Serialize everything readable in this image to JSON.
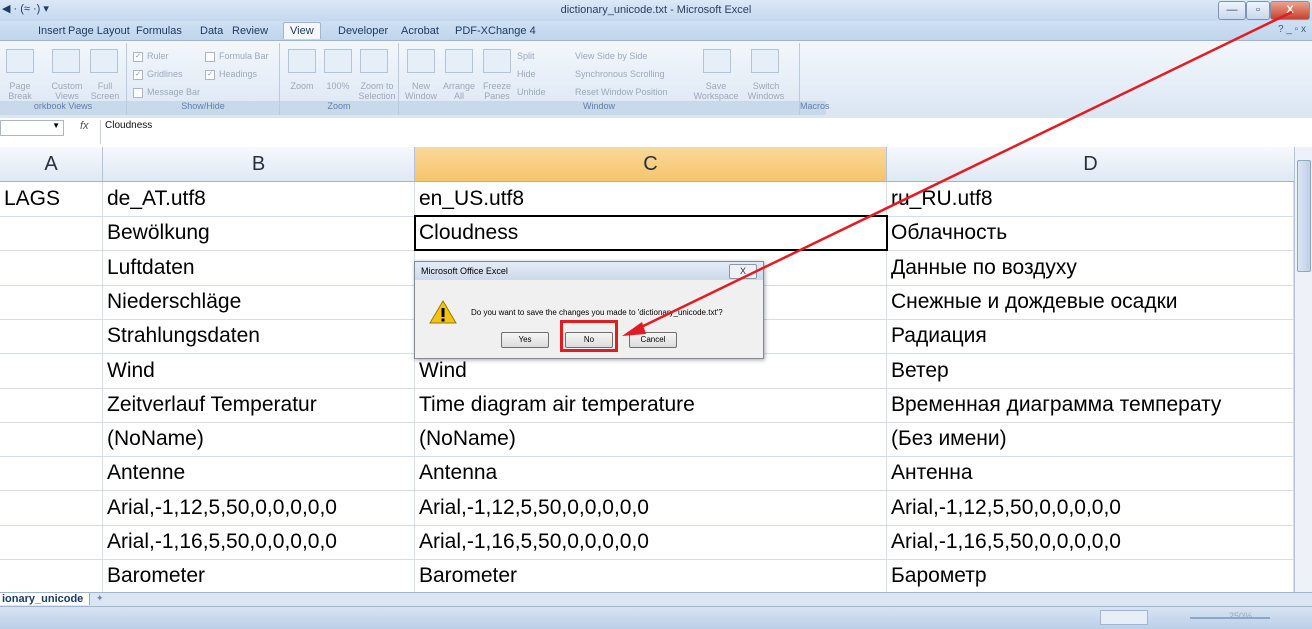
{
  "window": {
    "title": "dictionary_unicode.txt - Microsoft Excel",
    "qat_text": "◀ · (≈ ·) ▾",
    "buttons": {
      "minimize": "—",
      "restore": "▫",
      "close": "X"
    },
    "help": "?",
    "doc_controls": "_ ▫ x"
  },
  "ribbon": {
    "tabs": [
      "Insert",
      "Page Layout",
      "Formulas",
      "Data",
      "Review",
      "View",
      "Developer",
      "Acrobat",
      "PDF-XChange 4"
    ],
    "active_tab": "View",
    "groups": {
      "workbook_views": {
        "label": "orkbook Views",
        "items": [
          "Page Break Preview",
          "Custom Views",
          "Full Screen"
        ]
      },
      "show_hide": {
        "label": "Show/Hide",
        "checks": [
          {
            "label": "Ruler",
            "checked": true
          },
          {
            "label": "Gridlines",
            "checked": true
          },
          {
            "label": "Message Bar",
            "checked": false
          },
          {
            "label": "Formula Bar",
            "checked": false
          },
          {
            "label": "Headings",
            "checked": true
          }
        ]
      },
      "zoom": {
        "label": "Zoom",
        "items": [
          "Zoom",
          "100%",
          "Zoom to Selection"
        ]
      },
      "window": {
        "label": "Window",
        "items": [
          "New Window",
          "Arrange All",
          "Freeze Panes",
          "Split",
          "Hide",
          "Unhide",
          "View Side by Side",
          "Synchronous Scrolling",
          "Reset Window Position",
          "Save Workspace",
          "Switch Windows"
        ]
      },
      "macros": {
        "label": "Macros"
      }
    }
  },
  "formula_bar": {
    "name_box": "",
    "fx": "fx",
    "content": "Cloudness"
  },
  "columns": [
    "A",
    "B",
    "C",
    "D"
  ],
  "selected_column": "C",
  "rows": [
    [
      "LAGS",
      "de_AT.utf8",
      "en_US.utf8",
      "ru_RU.utf8"
    ],
    [
      "",
      " Bewölkung",
      " Cloudness",
      " Облачность"
    ],
    [
      "",
      " Luftdaten",
      "",
      " Данные по воздуху"
    ],
    [
      "",
      " Niederschläge",
      "",
      "Снежные и дождевые осадки"
    ],
    [
      "",
      " Strahlungsdaten",
      "",
      "Радиация"
    ],
    [
      "",
      " Wind",
      "Wind",
      " Ветер"
    ],
    [
      "",
      " Zeitverlauf Temperatur",
      " Time diagram air temperature",
      "Временная диаграмма температу"
    ],
    [
      "",
      "(NoName)",
      "(NoName)",
      "(Без имени)"
    ],
    [
      "",
      "Antenne",
      "Antenna",
      "Антенна"
    ],
    [
      "",
      "Arial,-1,12,5,50,0,0,0,0,0",
      "Arial,-1,12,5,50,0,0,0,0,0",
      "Arial,-1,12,5,50,0,0,0,0,0"
    ],
    [
      "",
      "Arial,-1,16,5,50,0,0,0,0,0",
      "Arial,-1,16,5,50,0,0,0,0,0",
      "Arial,-1,16,5,50,0,0,0,0,0"
    ],
    [
      "",
      "Barometer",
      "Barometer",
      "Барометр"
    ]
  ],
  "sheet_tab": "ionary_unicode",
  "status": {
    "zoom": "250%"
  },
  "dialog": {
    "title": "Microsoft Office Excel",
    "close": "X",
    "message": "Do you want to save the changes you made to 'dictionary_unicode.txt'?",
    "buttons": {
      "yes": "Yes",
      "no": "No",
      "cancel": "Cancel"
    }
  },
  "colors": {
    "annotation": "#e31b23",
    "selected_header": "#f6c46d"
  }
}
